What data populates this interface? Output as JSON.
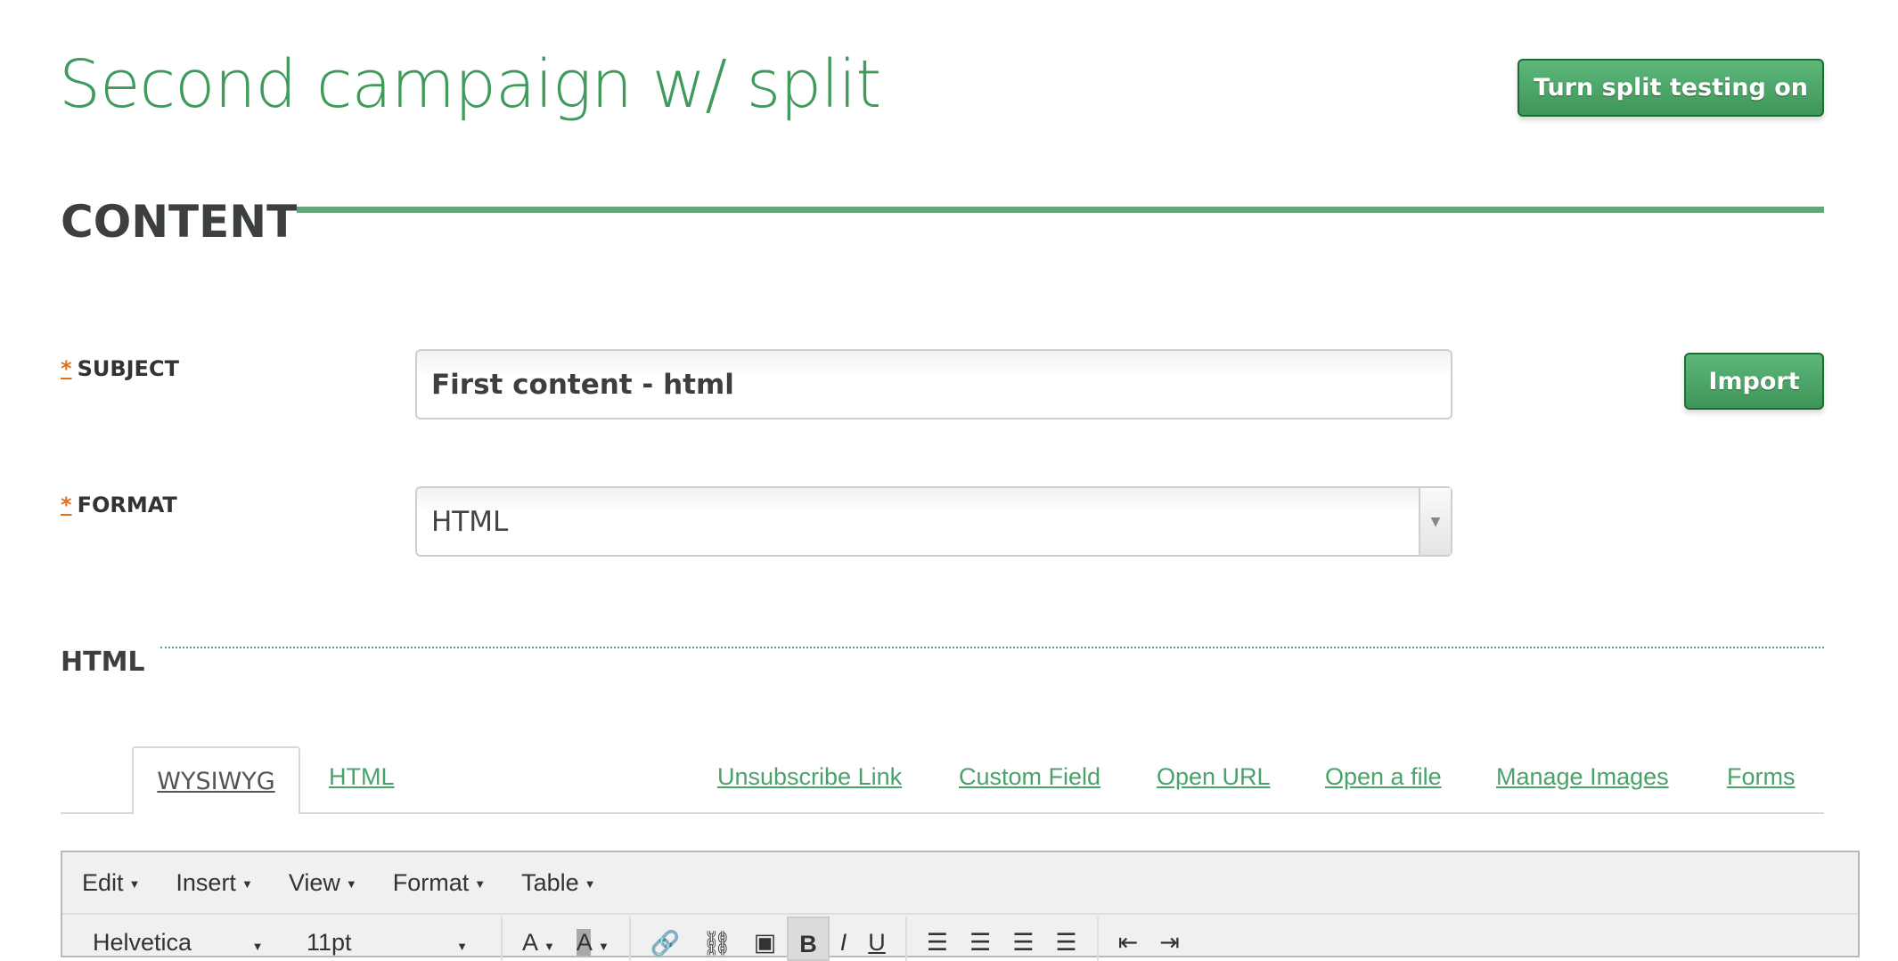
{
  "header": {
    "title": "Second campaign w/ split",
    "split_button": "Turn split testing on"
  },
  "section": {
    "heading": "CONTENT"
  },
  "form": {
    "subject": {
      "required": "*",
      "label": "SUBJECT",
      "value": "First content - html",
      "import_button": "Import"
    },
    "format": {
      "required": "*",
      "label": "FORMAT",
      "value": "HTML"
    }
  },
  "html_section": {
    "label": "HTML"
  },
  "tabs": [
    {
      "label": "WYSIWYG",
      "active": true
    },
    {
      "label": "HTML",
      "active": false
    }
  ],
  "links": [
    "Unsubscribe Link",
    "Custom Field",
    "Open URL",
    "Open a file",
    "Manage Images",
    "Forms"
  ],
  "editor": {
    "menu": [
      "Edit",
      "Insert",
      "View",
      "Format",
      "Table"
    ],
    "font": "Helvetica",
    "size": "11pt",
    "icons": [
      "text-color-icon",
      "background-color-icon",
      "link-icon",
      "unlink-icon",
      "image-icon",
      "bold-icon",
      "italic-icon",
      "underline-icon",
      "align-left-icon",
      "align-center-icon",
      "align-right-icon",
      "align-justify-icon",
      "outdent-icon",
      "indent-icon"
    ]
  },
  "colors": {
    "accent": "#3f9a5c",
    "button": "#4aa568",
    "required": "#e0701e"
  }
}
